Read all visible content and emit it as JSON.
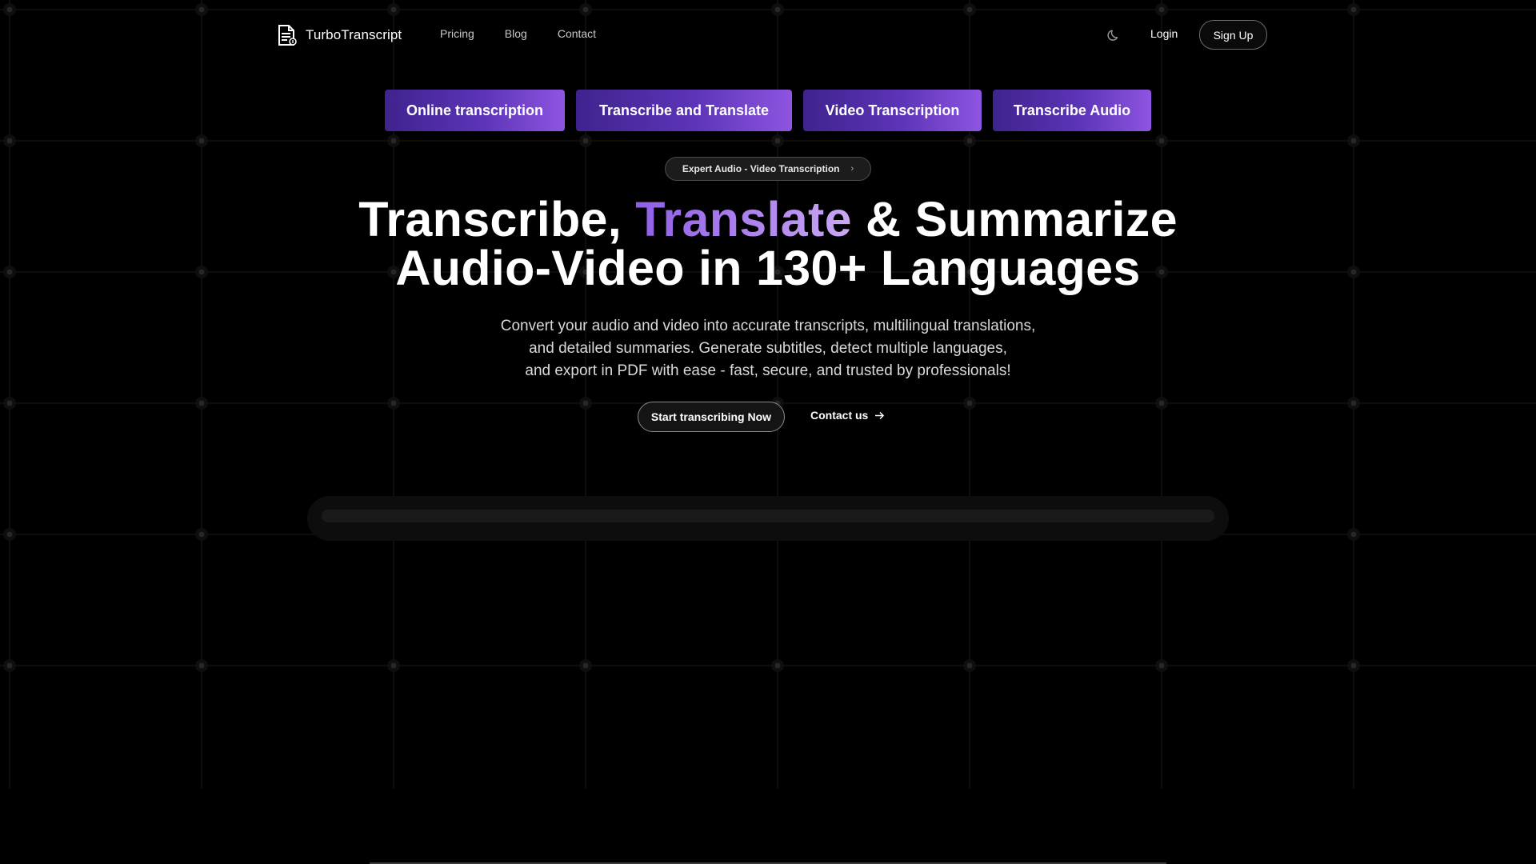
{
  "brand": {
    "name": "TurboTranscript",
    "logo_icon": "document-icon"
  },
  "nav": {
    "links": [
      {
        "label": "Pricing"
      },
      {
        "label": "Blog"
      },
      {
        "label": "Contact"
      }
    ],
    "theme_icon": "moon-icon",
    "login_label": "Login",
    "signup_label": "Sign Up"
  },
  "features": [
    {
      "label": "Online transcription"
    },
    {
      "label": "Transcribe and Translate"
    },
    {
      "label": "Video Transcription"
    },
    {
      "label": "Transcribe Audio"
    }
  ],
  "badge": {
    "label": "Expert Audio - Video Transcription",
    "chevron": "›"
  },
  "hero": {
    "title_part1": "Transcribe, ",
    "title_accent": "Translate",
    "title_part2": " & Summarize",
    "title_line2": "Audio-Video in 130+ Languages",
    "subtitle_line1": "Convert your audio and video into accurate transcripts, multilingual translations,",
    "subtitle_line2": "and detailed summaries. Generate subtitles, detect multiple languages,",
    "subtitle_line3": "and export in PDF with ease - fast, secure, and trusted by professionals!",
    "cta_primary": "Start transcribing Now",
    "cta_secondary": "Contact us",
    "cta_secondary_icon": "arrow-right-icon"
  },
  "colors": {
    "background": "#000000",
    "accent_start": "#3f238d",
    "accent_end": "#8e55e0",
    "headline_accent": "#b187ef"
  }
}
